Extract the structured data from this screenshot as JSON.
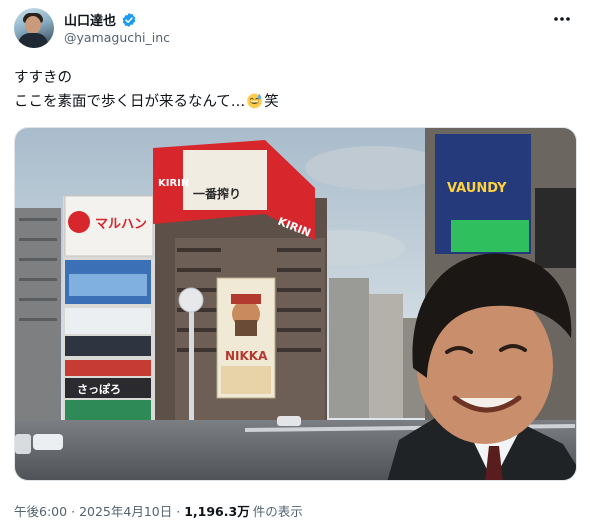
{
  "author": {
    "display_name": "山口達也",
    "handle": "@yamaguchi_inc",
    "verified_icon": "verified-badge-icon",
    "verified_color": "#1d9bf0"
  },
  "post": {
    "line1": "すすきの",
    "line2_before": "ここを素面で歩く日が来るなんて…",
    "emoji": "grinning-face-with-sweat-icon",
    "line2_after": "笑"
  },
  "photo": {
    "signs": {
      "maruhan": "マルハン",
      "kirin_top": "KIRIN",
      "ichiban": "一番搾り",
      "kirin_side": "KIRIN",
      "nikka": "NIKKA",
      "vaundy": "VAUNDY",
      "nihonzakari": "さっぽろ"
    }
  },
  "meta": {
    "time": "午後6:00",
    "separator": "·",
    "date": "2025年4月10日",
    "views_count": "1,196.3万",
    "views_label": "件の表示"
  },
  "colors": {
    "text": "#0f1419",
    "secondary": "#536471",
    "accent": "#1d9bf0"
  }
}
